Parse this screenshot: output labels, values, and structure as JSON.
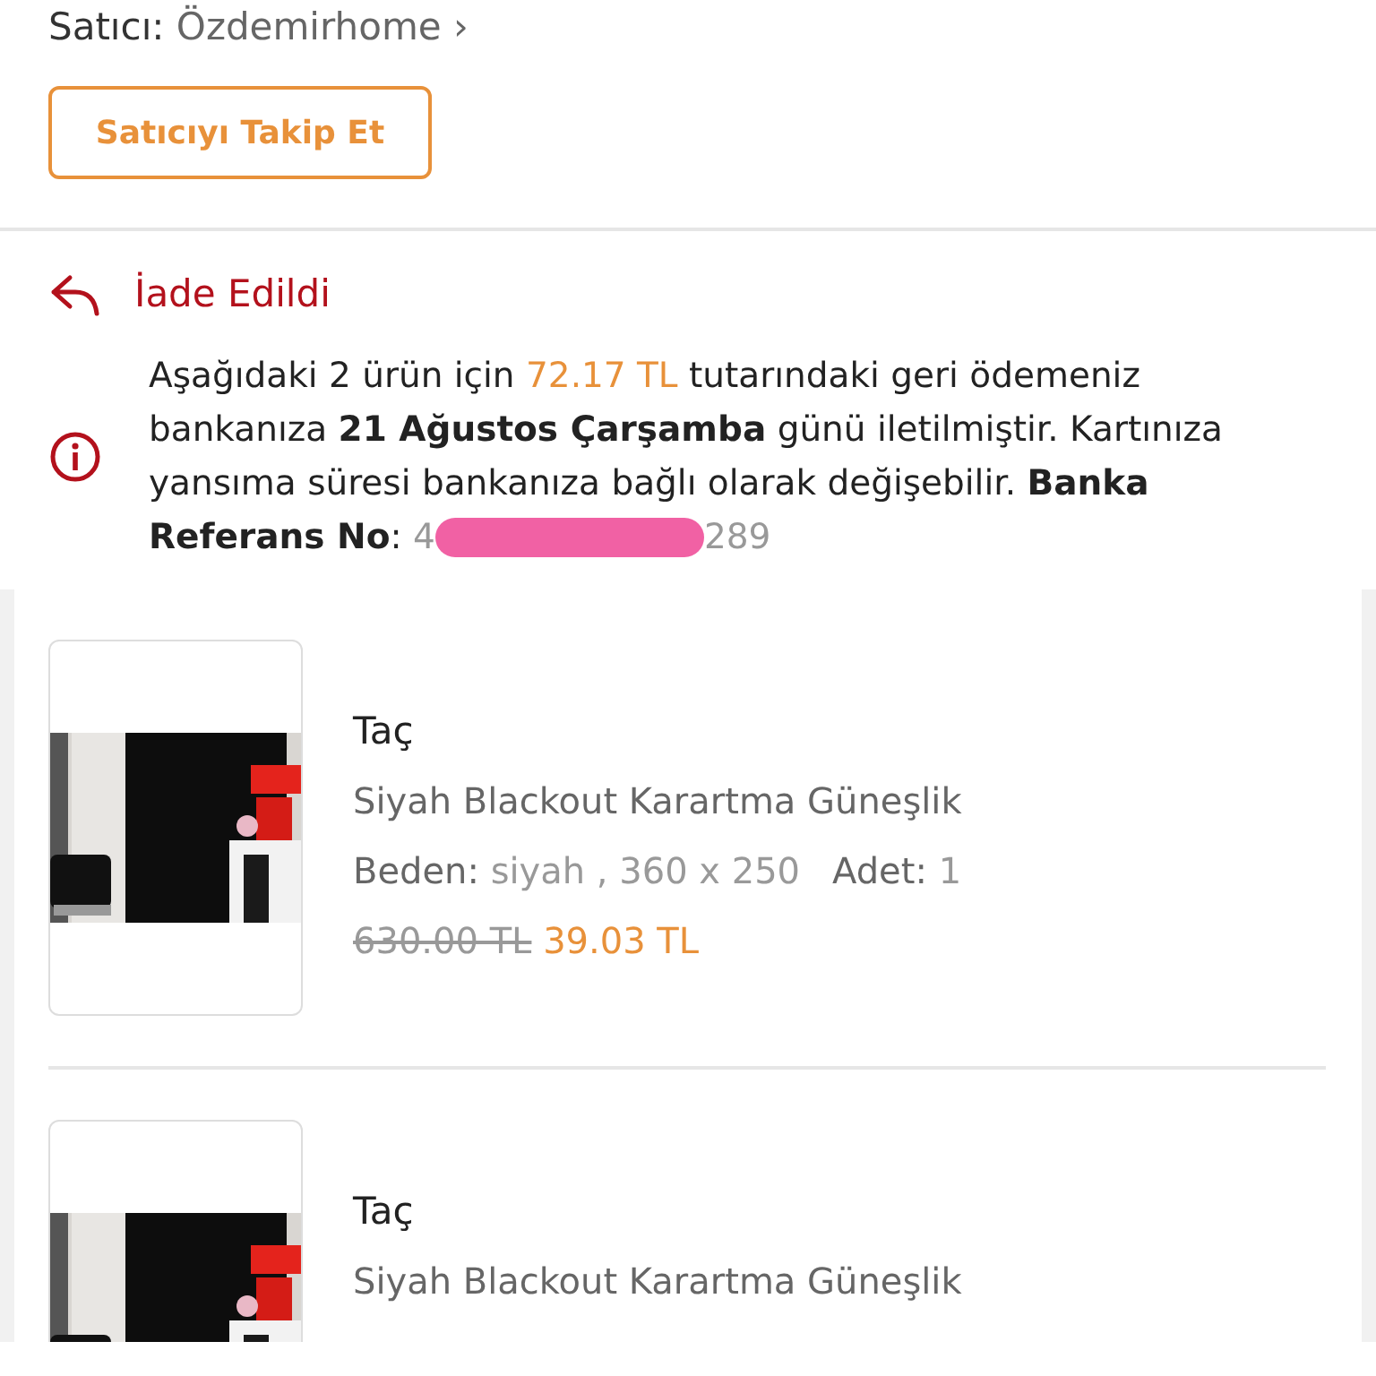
{
  "seller": {
    "label": "Satıcı:",
    "name": "Özdemirhome",
    "chevron": "›"
  },
  "follow_button": {
    "label": "Satıcıyı Takip Et"
  },
  "status": {
    "label": "İade Edildi"
  },
  "refund_note": {
    "text_before": "Aşağıdaki 2 ürün için",
    "amount": "72.17 TL",
    "text_after": "tutarındaki geri ödemeniz bankanıza **21 Ağustos Çarşamba** günü iletilmiştir. Kartınıza yansıma süresi bankanıza bağlı olarak değişebilir. **Banka Referans No**:",
    "reference_prefix": "4",
    "reference_suffix": "289",
    "redacted": true
  },
  "products": [
    {
      "brand": "Taç",
      "title": "Siyah Blackout Karartma Güneşlik",
      "size_label": "Beden:",
      "size": "siyah , 360 x 250",
      "qty_label": "Adet:",
      "qty": "1",
      "old_price": "630.00 TL",
      "price": "39.03 TL"
    },
    {
      "brand": "Taç",
      "title": "Siyah Blackout Karartma Güneşlik"
    }
  ]
}
